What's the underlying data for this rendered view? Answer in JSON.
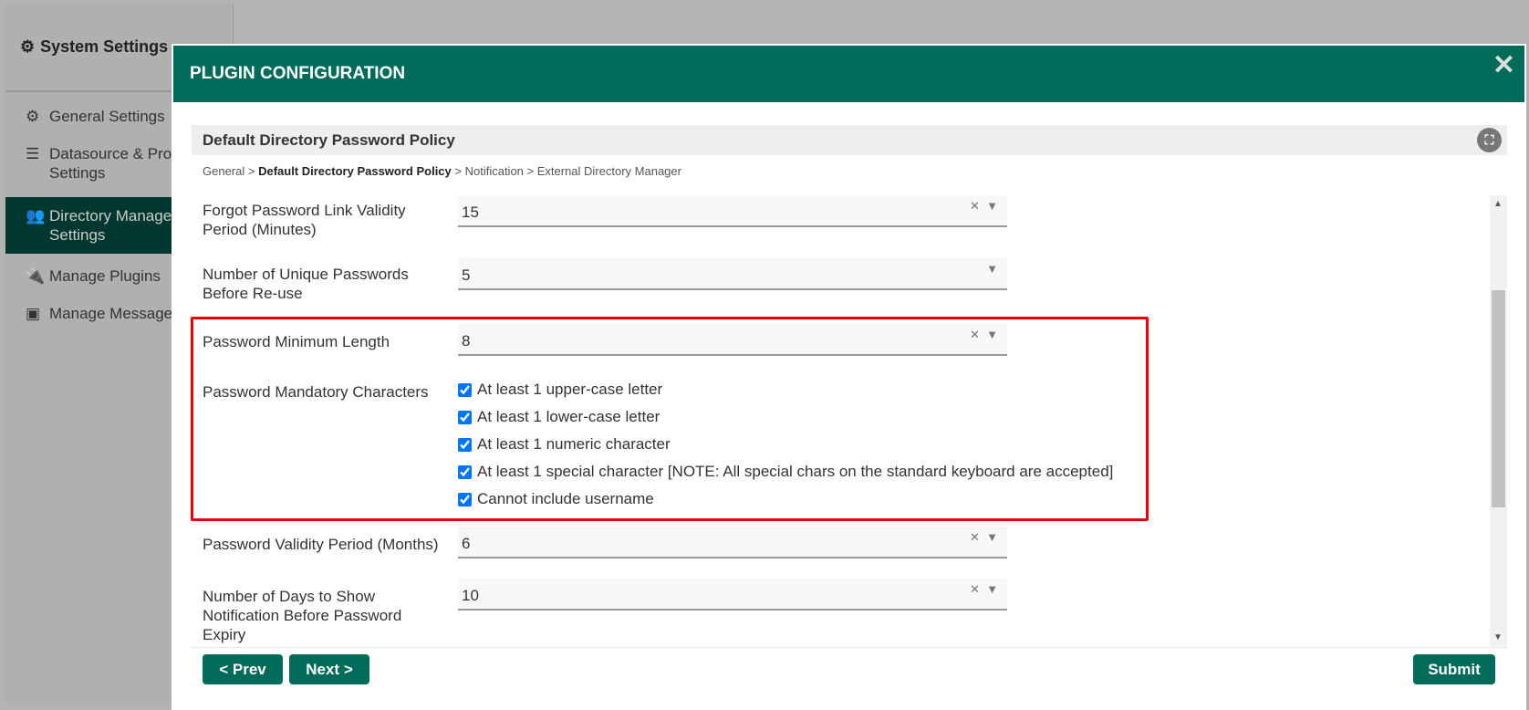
{
  "sidebar": {
    "title": "System Settings",
    "items": [
      {
        "label": "General Settings",
        "icon": "gear-icon"
      },
      {
        "label": "Datasource & Pro Settings",
        "icon": "database-icon"
      },
      {
        "label": "Directory Manage Settings",
        "icon": "users-gear-icon"
      },
      {
        "label": "Manage Plugins",
        "icon": "plug-icon"
      },
      {
        "label": "Manage Message",
        "icon": "language-icon"
      }
    ]
  },
  "modal": {
    "title": "PLUGIN CONFIGURATION",
    "section": "Default Directory Password Policy",
    "breadcrumb": [
      "General",
      "Default Directory Password Policy",
      "Notification",
      "External Directory Manager"
    ],
    "fields": [
      {
        "label": "Forgot Password Link Validity Period (Minutes)",
        "value": "15"
      },
      {
        "label": "Number of Unique Passwords Before Re-use",
        "value": "5"
      },
      {
        "label": "Password Minimum Length",
        "value": "8"
      },
      {
        "label": "Password Validity Period (Months)",
        "value": "6"
      },
      {
        "label": "Number of Days to Show Notification Before Password Expiry",
        "value": "10"
      }
    ],
    "mandatory_label": "Password Mandatory Characters",
    "checkboxes": [
      {
        "label": "At least 1 upper-case letter",
        "checked": true
      },
      {
        "label": "At least 1 lower-case letter",
        "checked": true
      },
      {
        "label": "At least 1 numeric character",
        "checked": true
      },
      {
        "label": "At least 1 special character [NOTE: All special chars on the standard keyboard are accepted]",
        "checked": true
      },
      {
        "label": "Cannot include username",
        "checked": true
      }
    ],
    "prev": "< Prev",
    "next": "Next >",
    "submit": "Submit",
    "clear": "✕",
    "caret": "▼"
  }
}
